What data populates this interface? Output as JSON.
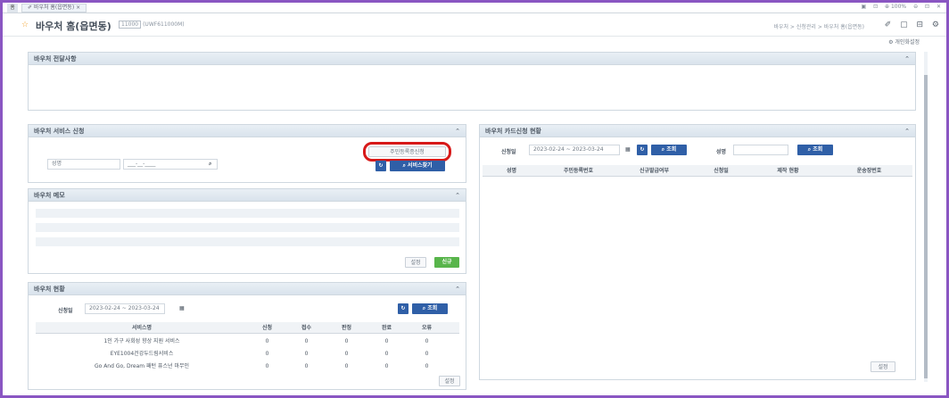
{
  "tabbar": {
    "home_label": "홈",
    "tab_label": "✐ 바우처 홈(읍면동) ×",
    "tools": [
      "▣",
      "⊡",
      "⊕ 100%",
      "⊖",
      "⊡",
      "✕"
    ]
  },
  "header": {
    "title": "바우처 홈(읍면동)",
    "menu_code": "11000",
    "program_id": "(UWF611000M)",
    "breadcrumb": "바우처  >  신청관리  >  바우처 홈(읍면동)",
    "icons": [
      "✐",
      "▢",
      "⊟",
      "⚙"
    ]
  },
  "personal_settings": "⚙ 개인화설정",
  "notice_panel": {
    "title": "바우처 전달사항",
    "collapse": "⌃"
  },
  "service_panel": {
    "title": "바우처 서비스 신청",
    "collapse": "⌃",
    "name_placeholder": "성명",
    "birth_value": "___-__-____",
    "search_icon": "⌕",
    "highlight_button": "주민등록증신청",
    "reset_icon": "↻",
    "search_button": "⌕ 서비스찾기"
  },
  "memo_panel": {
    "title": "바우처 메모",
    "collapse": "⌃",
    "settings_button": "설정",
    "new_button": "신규"
  },
  "status_panel": {
    "title": "바우처 현황",
    "collapse": "⌃",
    "date_label": "신청일",
    "date_range": "2023-02-24 ~ 2023-03-24",
    "calendar_icon": "▦",
    "reset_icon": "↻",
    "search_button": "⌕ 조회",
    "columns": [
      "서비스명",
      "신청",
      "접수",
      "판정",
      "완료",
      "오류"
    ],
    "rows": [
      {
        "name": "1인 가구 사회성 향상 지원 서비스",
        "c1": "0",
        "c2": "0",
        "c3": "0",
        "c4": "0",
        "c5": "0"
      },
      {
        "name": "EYE1004건강두드림서비스",
        "c1": "0",
        "c2": "0",
        "c3": "0",
        "c4": "0",
        "c5": "0"
      },
      {
        "name": "Go And Go, Dream 패턴 퓨스넌 마무인",
        "c1": "0",
        "c2": "0",
        "c3": "0",
        "c4": "0",
        "c5": "0"
      }
    ],
    "settings_button": "설정"
  },
  "card_panel": {
    "title": "바우처 카드신청 현황",
    "collapse": "⌃",
    "date_label": "신청일",
    "date_range": "2023-02-24 ~ 2023-03-24",
    "calendar_icon": "▦",
    "reset_icon": "↻",
    "search_button": "⌕ 조회",
    "name_label": "성명",
    "name_search_button": "⌕ 조회",
    "columns": [
      "성명",
      "주민등록번호",
      "신규발급여부",
      "신청일",
      "제작 현황",
      "운송장번호"
    ],
    "settings_button": "설정"
  }
}
